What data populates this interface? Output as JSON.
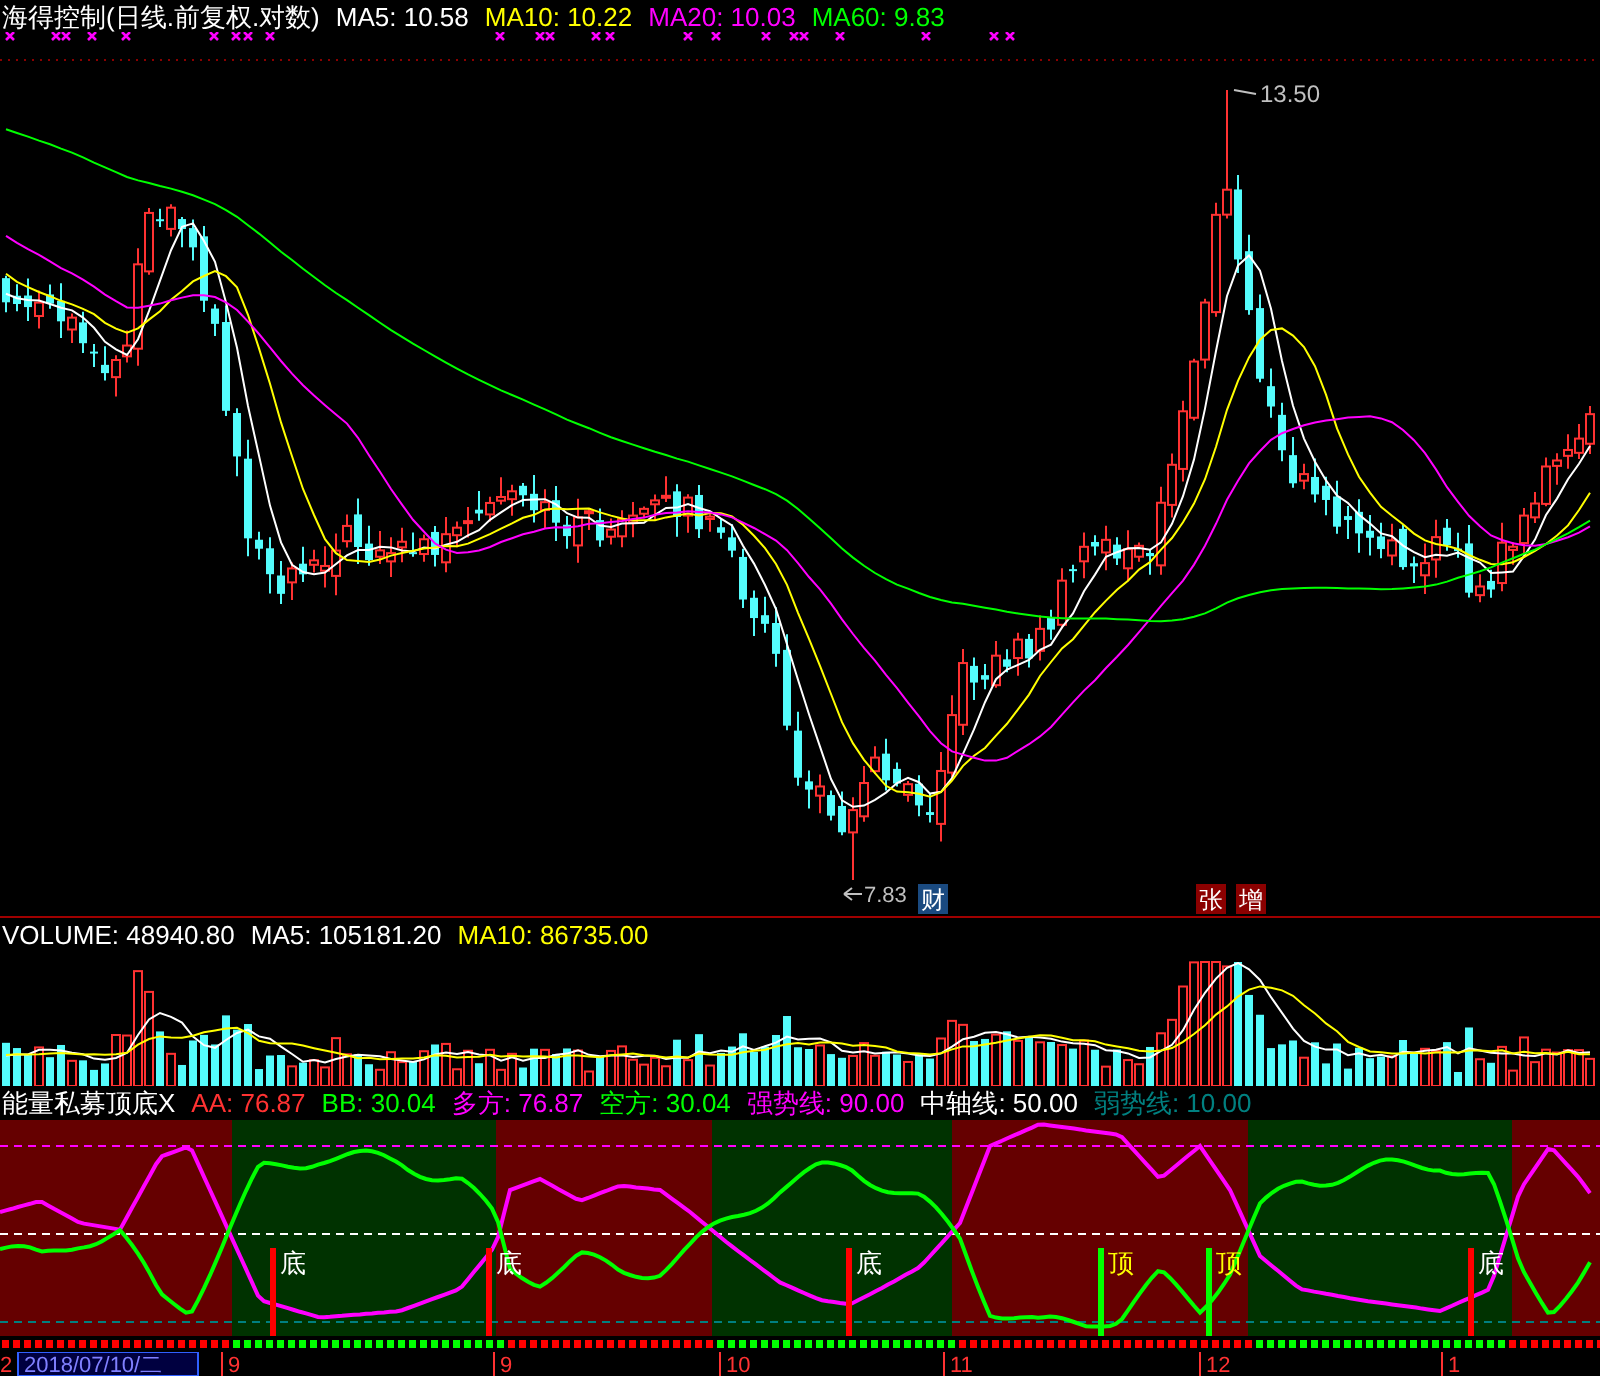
{
  "main_panel": {
    "title": "海得控制(日线.前复权.对数)",
    "legend": [
      {
        "label": "MA5: 10.58",
        "color": "#ffffff"
      },
      {
        "label": "MA10: 10.22",
        "color": "#ffff00"
      },
      {
        "label": "MA20: 10.03",
        "color": "#ff00ff"
      },
      {
        "label": "MA60: 9.83",
        "color": "#00ff00"
      }
    ],
    "high_label": "13.50",
    "low_label": "7.83",
    "badges": [
      {
        "text": "财",
        "color": "#1a4a80"
      },
      {
        "text": "张",
        "color": "#8b0000"
      },
      {
        "text": "增",
        "color": "#8b0000"
      }
    ]
  },
  "volume_panel": {
    "legend": [
      {
        "label": "VOLUME: 48940.80",
        "color": "#ffffff"
      },
      {
        "label": "MA5: 105181.20",
        "color": "#ffffff"
      },
      {
        "label": "MA10: 86735.00",
        "color": "#ffff00"
      }
    ]
  },
  "indicator_panel": {
    "title": "能量私募顶底X",
    "legend": [
      {
        "label": "AA: 76.87",
        "color": "#ff3232"
      },
      {
        "label": "BB: 30.04",
        "color": "#00ff00"
      },
      {
        "label": "多方: 76.87",
        "color": "#ff00ff"
      },
      {
        "label": "空方: 30.04",
        "color": "#00ff00"
      },
      {
        "label": "强势线: 90.00",
        "color": "#ff00ff"
      },
      {
        "label": "中轴线: 50.00",
        "color": "#ffffff"
      },
      {
        "label": "弱势线: 10.00",
        "color": "#008080"
      }
    ],
    "signals": [
      {
        "label": "底",
        "kind": "bottom"
      },
      {
        "label": "底",
        "kind": "bottom"
      },
      {
        "label": "底",
        "kind": "bottom"
      },
      {
        "label": "顶",
        "kind": "top"
      },
      {
        "label": "顶",
        "kind": "top"
      },
      {
        "label": "底",
        "kind": "bottom"
      }
    ]
  },
  "axis": {
    "edge_label": "2",
    "cursor_date": "2018/07/10/二",
    "months": [
      "9",
      "9",
      "10",
      "11",
      "12",
      "1"
    ]
  }
}
